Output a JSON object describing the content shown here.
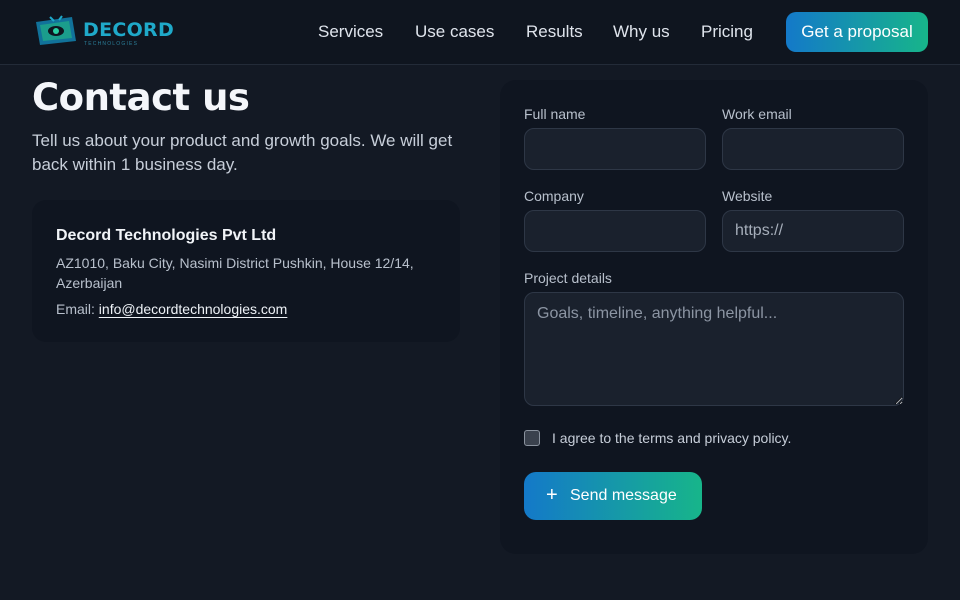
{
  "nav": {
    "brand": "DECORD",
    "brand_tagline": "TECHNOLOGIES",
    "links": [
      "Services",
      "Use cases",
      "Results",
      "Why us",
      "Pricing"
    ],
    "cta_label": "Get a proposal",
    "logo_icon": "tv-screen-eye-logo"
  },
  "contact": {
    "title": "Contact us",
    "intro": "Tell us about your product and growth goals. We will get back within 1 business day.",
    "company": "Decord Technologies Pvt Ltd",
    "address": "AZ1010, Baku City, Nasimi District Pushkin, House 12/14, Azerbaijan",
    "email_label": "Email:",
    "email": "info@decordtechnologies.com"
  },
  "form": {
    "full_name_label": "Full name",
    "full_name_value": "",
    "work_email_label": "Work email",
    "work_email_value": "",
    "company_label": "Company",
    "company_value": "",
    "website_label": "Website",
    "website_placeholder": "https://",
    "project_label": "Project details",
    "project_placeholder": "Goals, timeline, anything helpful...",
    "terms_label": "I agree to the terms and privacy policy.",
    "terms_checked": false,
    "submit_label": "Send message",
    "submit_icon": "plus-icon"
  },
  "colors": {
    "background": "#131924",
    "card": "#0f1520",
    "accent_start": "#1479c9",
    "accent_end": "#17b58a"
  }
}
